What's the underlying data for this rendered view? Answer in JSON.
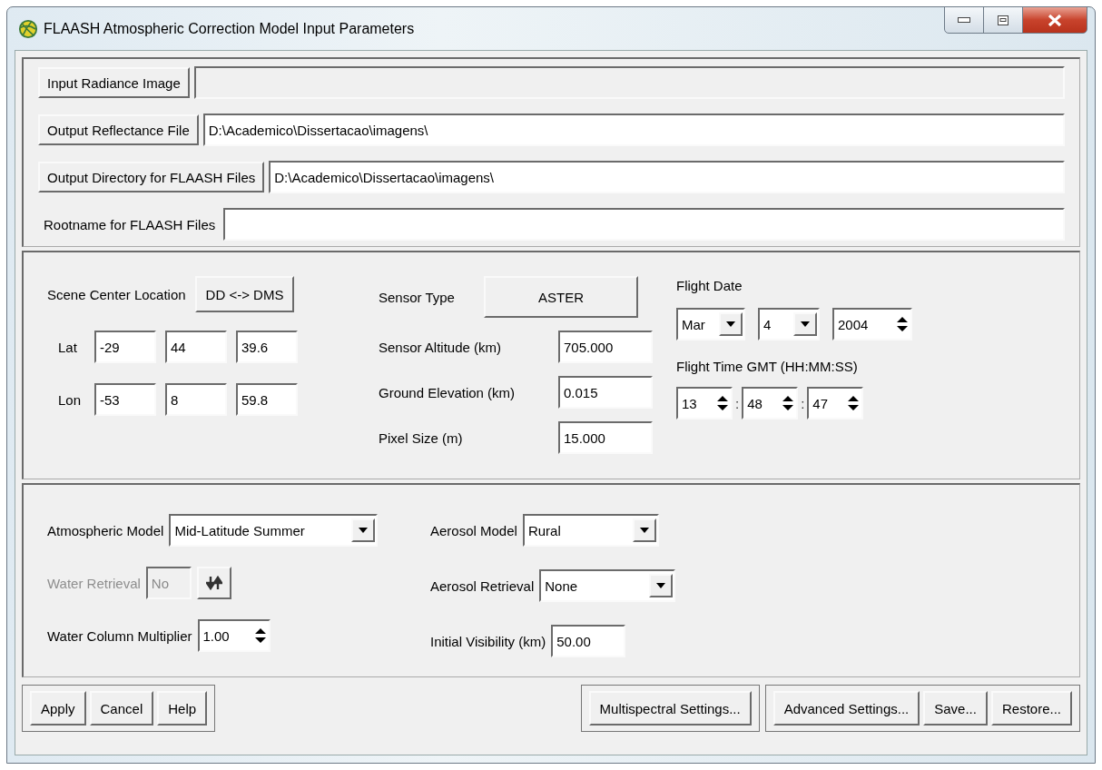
{
  "window": {
    "title": "FLAASH Atmospheric Correction Model Input Parameters"
  },
  "files": [
    {
      "kind": "button",
      "label": "Input Radiance Image",
      "disabled": true
    },
    {
      "kind": "button",
      "label": "Output Reflectance File",
      "value": "D:\\Academico\\Dissertacao\\imagens\\",
      "disabled": false
    },
    {
      "kind": "button",
      "label": "Output Directory for FLAASH Files",
      "value": "D:\\Academico\\Dissertacao\\imagens\\",
      "disabled": false
    },
    {
      "kind": "label",
      "label": "Rootname for FLAASH Files",
      "disabled": false
    }
  ],
  "location": {
    "label": "Scene Center Location",
    "toggle": "DD <-> DMS",
    "rows": [
      {
        "label": "Lat",
        "values": [
          "-29",
          "44",
          "39.6"
        ]
      },
      {
        "label": "Lon",
        "values": [
          "-53",
          "8",
          "59.8"
        ]
      }
    ]
  },
  "sensor": {
    "type_label": "Sensor Type",
    "type": "ASTER",
    "fields": [
      {
        "label": "Sensor Altitude (km)",
        "value": "705.000"
      },
      {
        "label": "Ground Elevation (km)",
        "value": "0.015"
      },
      {
        "label": "Pixel Size (m)",
        "value": "15.000"
      }
    ]
  },
  "flight": {
    "date_label": "Flight Date",
    "month": "Mar",
    "day": "4",
    "year": "2004",
    "time_label": "Flight Time GMT (HH:MM:SS)",
    "time": [
      "13",
      "48",
      "47"
    ],
    "separators": [
      ":",
      ":"
    ]
  },
  "atmosphere": {
    "left": [
      {
        "kind": "dropdown",
        "label": "Atmospheric Model",
        "value": "Mid-Latitude Summer",
        "disabled": false
      },
      {
        "kind": "toggle",
        "label": "Water Retrieval",
        "value": "No",
        "disabled": true
      },
      {
        "kind": "spinner",
        "label": "Water Column Multiplier",
        "value": "1.00",
        "disabled": false
      }
    ],
    "right": [
      {
        "kind": "dropdown",
        "label": "Aerosol Model",
        "value": "Rural",
        "disabled": false
      },
      {
        "kind": "dropdown",
        "label": "Aerosol Retrieval",
        "value": "None",
        "disabled": false
      },
      {
        "kind": "field",
        "label": "Initial Visibility (km)",
        "value": "50.00",
        "disabled": false
      }
    ]
  },
  "buttons": [
    [
      "Apply",
      "Cancel",
      "Help"
    ],
    [
      "Multispectral Settings..."
    ],
    [
      "Advanced Settings...",
      "Save...",
      "Restore..."
    ]
  ]
}
